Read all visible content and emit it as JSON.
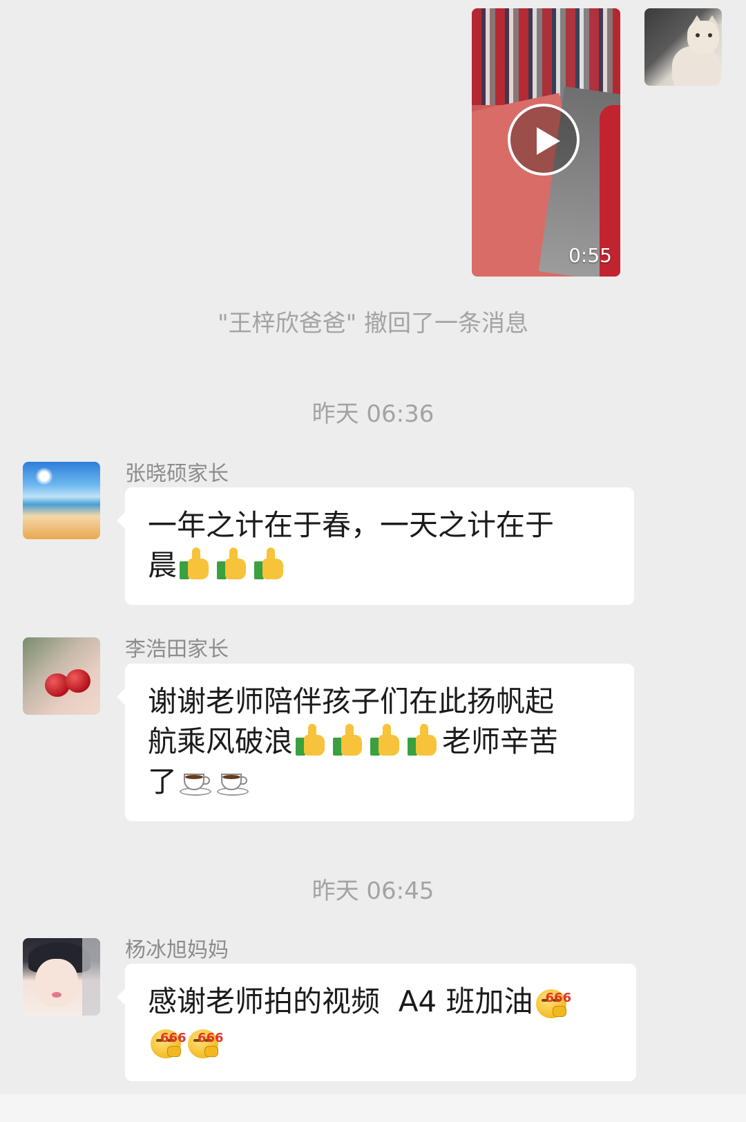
{
  "video_message": {
    "duration": "0:55"
  },
  "recall_notice": "\"王梓欣爸爸\" 撤回了一条消息",
  "timestamps": [
    "昨天 06:36",
    "昨天 06:45"
  ],
  "messages": [
    {
      "sender": "张晓硕家长",
      "parts": [
        "一年之计在于春，一天之计在于\n晨"
      ],
      "emoji_after": [
        "thumbs-up",
        "thumbs-up",
        "thumbs-up"
      ]
    },
    {
      "sender": "李浩田家长",
      "line1": "谢谢老师陪伴孩子们在此扬帆起",
      "line2a": "航乘风破浪",
      "line2b": "老师辛苦",
      "line3": "了",
      "emoji_mid": [
        "thumbs-up",
        "thumbs-up",
        "thumbs-up",
        "thumbs-up"
      ],
      "emoji_end": [
        "coffee",
        "coffee"
      ]
    },
    {
      "sender": "杨冰旭妈妈",
      "text": "感谢老师拍的视频  A4 班加油",
      "emoji_666_label": "666",
      "emoji_count": 3
    }
  ]
}
